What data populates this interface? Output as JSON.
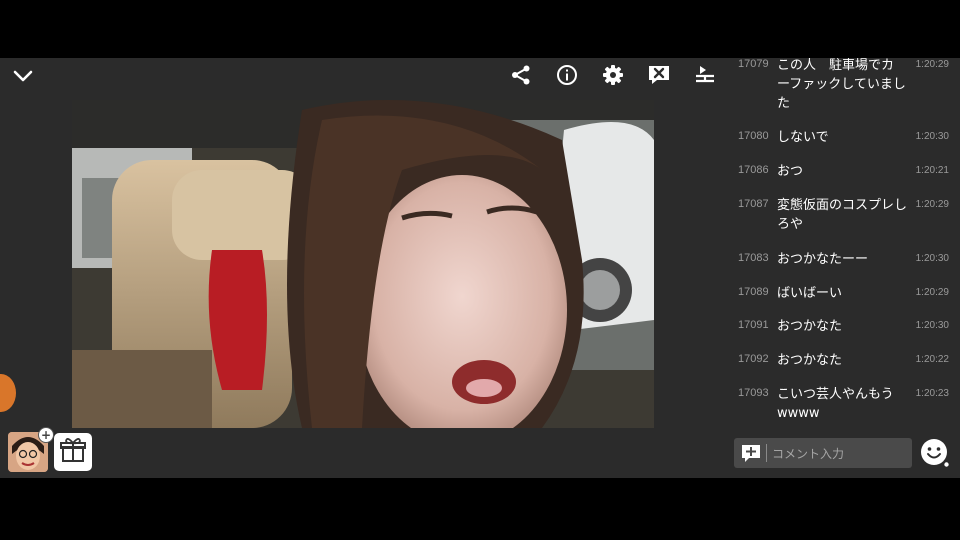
{
  "toolbar": {
    "icons": [
      "chevron-down-icon",
      "share-icon",
      "info-icon",
      "gear-icon",
      "close-comments-icon",
      "download-icon"
    ]
  },
  "comments": [
    {
      "number": "17079",
      "text": "この人　駐車場でカーファックしていました",
      "time": "1:20:29"
    },
    {
      "number": "17080",
      "text": "しないで",
      "time": "1:20:30"
    },
    {
      "number": "17086",
      "text": "おつ",
      "time": "1:20:21"
    },
    {
      "number": "17087",
      "text": "変態仮面のコスプレしろや",
      "time": "1:20:29"
    },
    {
      "number": "17083",
      "text": "おつかなたーー",
      "time": "1:20:30"
    },
    {
      "number": "17089",
      "text": "ばいばーい",
      "time": "1:20:29"
    },
    {
      "number": "17091",
      "text": "おつかなた",
      "time": "1:20:30"
    },
    {
      "number": "17092",
      "text": "おつかなた",
      "time": "1:20:22"
    },
    {
      "number": "17093",
      "text": "こいつ芸人やんもうwwww",
      "time": "1:20:23"
    }
  ],
  "comment_input": {
    "placeholder": "コメント入力"
  },
  "colors": {
    "panel_bg": "#2b2b2b",
    "text_primary": "#ffffff",
    "text_muted": "#9a9a9a",
    "accent_orange": "#d9762a"
  }
}
